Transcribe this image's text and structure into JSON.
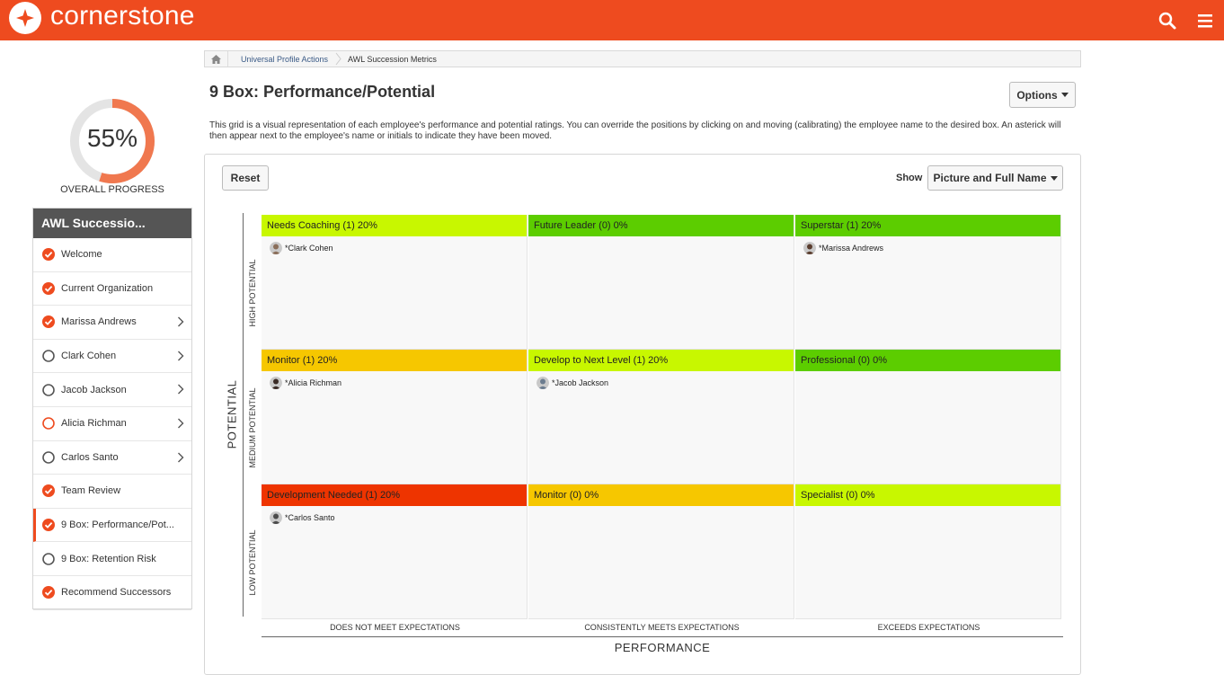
{
  "header": {
    "brand": "cornerstone",
    "icons": {
      "search": "search-icon",
      "menu": "hamburger-menu-icon"
    },
    "color": "#ee4b1f"
  },
  "progress": {
    "percent_text": "55%",
    "value": 0.55,
    "label": "OVERALL PROGRESS"
  },
  "sidebar": {
    "title": "AWL Successio...",
    "items": [
      {
        "label": "Welcome",
        "status": "complete",
        "chevron": false
      },
      {
        "label": "Current Organization",
        "status": "complete",
        "chevron": false
      },
      {
        "label": "Marissa Andrews",
        "status": "complete",
        "chevron": true
      },
      {
        "label": "Clark Cohen",
        "status": "incomplete",
        "chevron": true
      },
      {
        "label": "Jacob Jackson",
        "status": "incomplete",
        "chevron": true
      },
      {
        "label": "Alicia Richman",
        "status": "in-progress",
        "chevron": true
      },
      {
        "label": "Carlos Santo",
        "status": "incomplete",
        "chevron": true
      },
      {
        "label": "Team Review",
        "status": "complete",
        "chevron": false
      },
      {
        "label": "9 Box: Performance/Pot...",
        "status": "complete",
        "chevron": false,
        "active": true
      },
      {
        "label": "9 Box: Retention Risk",
        "status": "incomplete",
        "chevron": false
      },
      {
        "label": "Recommend Successors",
        "status": "complete",
        "chevron": false
      }
    ]
  },
  "breadcrumb": {
    "home": "home-icon",
    "items": [
      "Universal Profile Actions",
      "AWL Succession Metrics"
    ]
  },
  "page": {
    "title": "9 Box: Performance/Potential",
    "options_label": "Options",
    "description": "This grid is a visual representation of each employee's performance and potential ratings. You can override the positions by clicking on and moving (calibrating) the employee name to the desired box. An asterick will then appear next to the employee's name or initials to indicate they have been moved."
  },
  "controls": {
    "reset_label": "Reset",
    "show_label": "Show",
    "show_value": "Picture and Full Name"
  },
  "grid": {
    "y_title": "POTENTIAL",
    "x_title": "PERFORMANCE",
    "rows": [
      "HIGH POTENTIAL",
      "MEDIUM POTENTIAL",
      "LOW POTENTIAL"
    ],
    "cols": [
      "DOES NOT MEET EXPECTATIONS",
      "CONSISTENTLY MEETS EXPECTATIONS",
      "EXCEEDS EXPECTATIONS"
    ],
    "cells": [
      [
        {
          "title": "Needs Coaching (1) 20%",
          "color": "#c8f700",
          "employees": [
            "*Clark Cohen"
          ]
        },
        {
          "title": "Future Leader (0) 0%",
          "color": "#5ccd00",
          "employees": []
        },
        {
          "title": "Superstar (1) 20%",
          "color": "#5ccd00",
          "employees": [
            "*Marissa Andrews"
          ]
        }
      ],
      [
        {
          "title": "Monitor (1) 20%",
          "color": "#f6c700",
          "employees": [
            "*Alicia Richman"
          ]
        },
        {
          "title": "Develop to Next Level (1) 20%",
          "color": "#c8f700",
          "employees": [
            "*Jacob Jackson"
          ]
        },
        {
          "title": "Professional (0) 0%",
          "color": "#5ccd00",
          "employees": []
        }
      ],
      [
        {
          "title": "Development Needed (1) 20%",
          "color": "#ee3400",
          "employees": [
            "*Carlos Santo"
          ]
        },
        {
          "title": "Monitor (0) 0%",
          "color": "#f6c700",
          "employees": []
        },
        {
          "title": "Specialist (0) 0%",
          "color": "#c8f700",
          "employees": []
        }
      ]
    ]
  }
}
